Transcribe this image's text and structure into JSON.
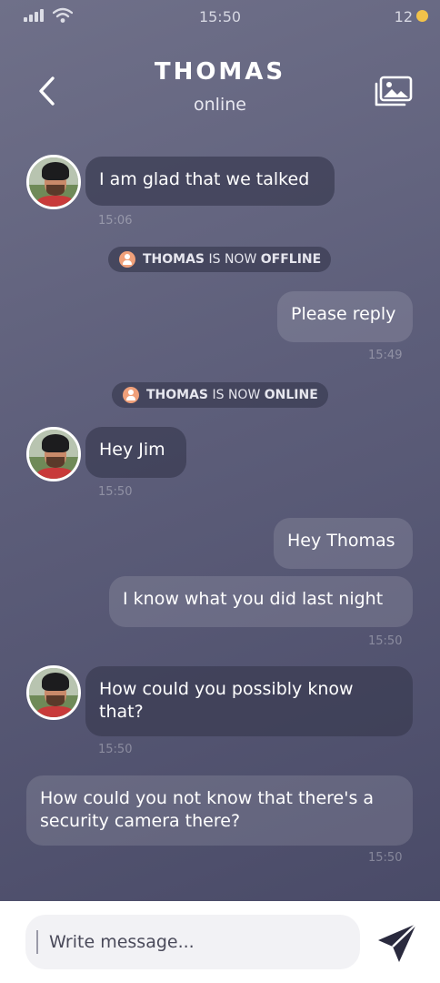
{
  "status_bar": {
    "time": "15:50",
    "notification_count": "12",
    "icons": [
      "signal-icon",
      "wifi-icon",
      "notification-dot-icon"
    ]
  },
  "header": {
    "title": "THOMAS",
    "status": "online",
    "icons": [
      "back-arrow-icon",
      "gallery-icon"
    ]
  },
  "messages": [
    {
      "side": "incoming",
      "text": "I am glad that we talked",
      "time": "15:06"
    },
    {
      "side": "outgoing",
      "text": "Please reply",
      "time": "15:49"
    },
    {
      "side": "incoming",
      "text": "Hey Jim",
      "time": "15:50"
    },
    {
      "side": "outgoing",
      "text": "Hey Thomas"
    },
    {
      "side": "outgoing",
      "text": "I know what you did last night",
      "time": "15:50"
    },
    {
      "side": "incoming",
      "text": "How could you possibly know that?",
      "time": "15:50"
    },
    {
      "side": "incoming",
      "text": "How could you not know that there's a security camera there?",
      "time": "15:50"
    }
  ],
  "notices": [
    {
      "name": "THOMAS",
      "middle": "IS NOW",
      "state": "OFFLINE"
    },
    {
      "name": "THOMAS",
      "middle": "IS NOW",
      "state": "ONLINE"
    }
  ],
  "composer": {
    "placeholder": "Write message...",
    "send_icon": "send-icon"
  },
  "colors": {
    "background_top": "#6f7089",
    "background_bottom": "#4a4b68",
    "incoming_bubble": "#3a3b52",
    "notice_icon": "#f0a07a",
    "status_dot": "#f2c24a"
  }
}
